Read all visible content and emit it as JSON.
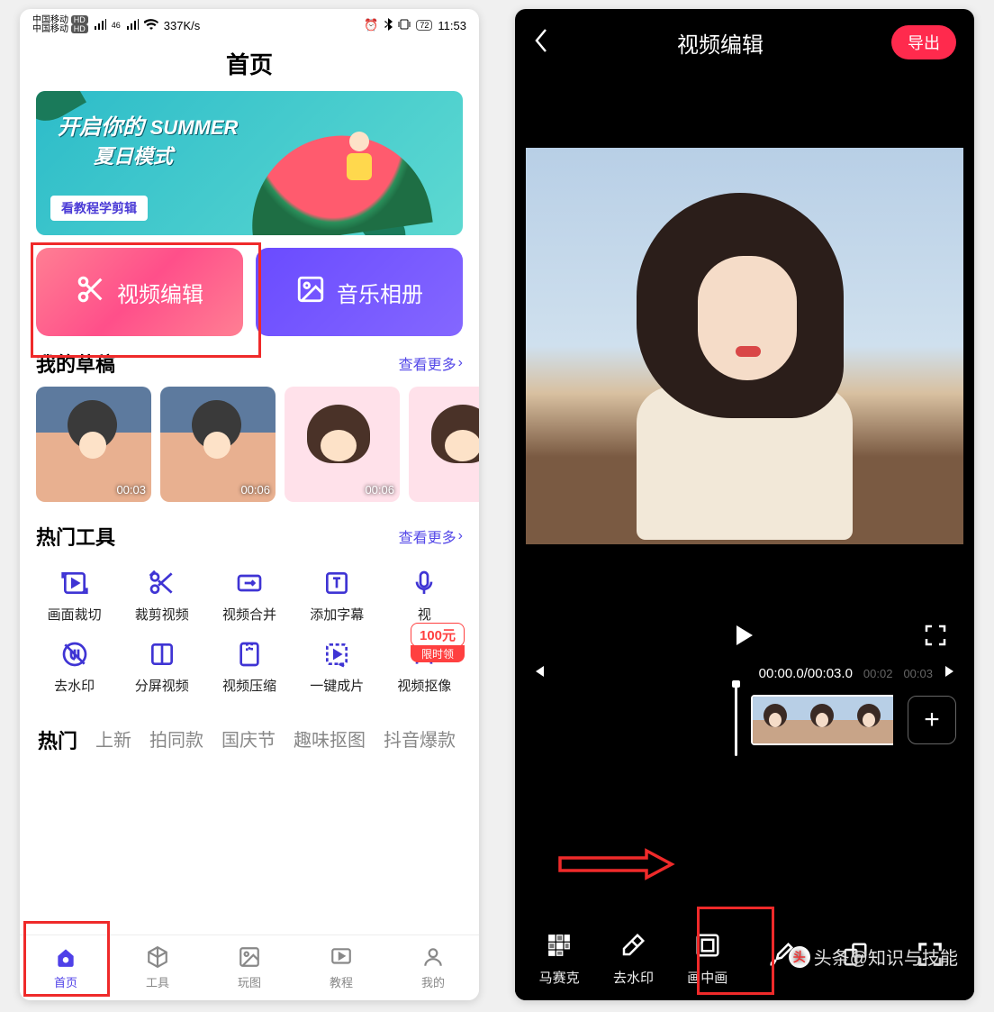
{
  "left": {
    "statusbar": {
      "carrier": "中国移动",
      "hd": "HD",
      "net_speed": "337K/s",
      "battery": "72",
      "time": "11:53"
    },
    "page_title": "首页",
    "banner": {
      "line1a": "开启你的",
      "line1b": "SUMMER",
      "line2": "夏日模式",
      "tag": "看教程学剪辑"
    },
    "actions": {
      "video_edit": "视频编辑",
      "music_album": "音乐相册"
    },
    "drafts": {
      "title": "我的草稿",
      "more": "查看更多",
      "items": [
        {
          "duration": "00:03"
        },
        {
          "duration": "00:06"
        },
        {
          "duration": "00:06"
        },
        {
          "duration": ""
        }
      ]
    },
    "hot_tools": {
      "title": "热门工具",
      "more": "查看更多",
      "items": [
        "画面裁切",
        "裁剪视频",
        "视频合并",
        "添加字幕",
        "视",
        "去水印",
        "分屏视频",
        "视频压缩",
        "一键成片",
        "视频抠像"
      ],
      "promo_amount": "100元",
      "promo_tag": "限时领"
    },
    "categories": [
      "热门",
      "上新",
      "拍同款",
      "国庆节",
      "趣味抠图",
      "抖音爆款"
    ],
    "nav": [
      "首页",
      "工具",
      "玩图",
      "教程",
      "我的"
    ]
  },
  "right": {
    "title": "视频编辑",
    "export": "导出",
    "timecode_current": "00:00.0",
    "timecode_total": "00:03.0",
    "tick1": "00:02",
    "tick2": "00:03",
    "tools": [
      "马赛克",
      "去水印",
      "画中画",
      "",
      "",
      ""
    ],
    "tool_names": [
      "mosaic",
      "remove-watermark",
      "picture-in-picture",
      "brush",
      "merge",
      "fullscreen-tool"
    ]
  },
  "watermark": "头条@知识与技能"
}
